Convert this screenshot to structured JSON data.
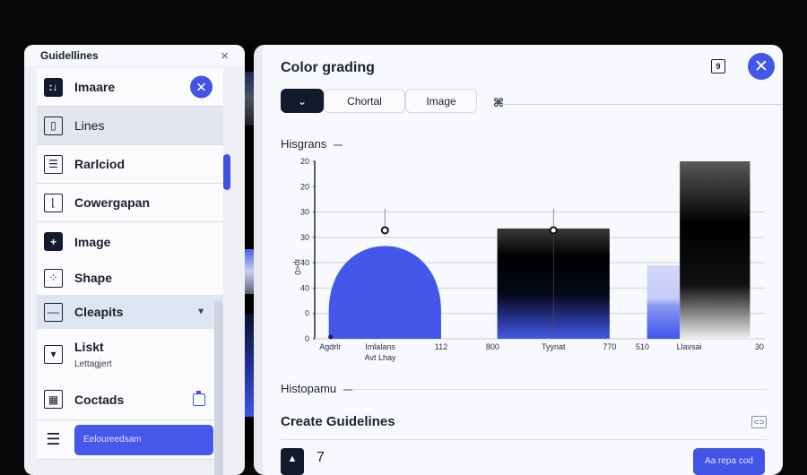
{
  "left_panel": {
    "title": "Guidellines",
    "close_icon": "×",
    "items": [
      {
        "label": "Imaare",
        "icon": "adjust-icon",
        "glyph": ":↓",
        "style": "solid",
        "trailing": "close-circle"
      },
      {
        "label": "Lines",
        "icon": "layers-icon",
        "glyph": "▯",
        "style": "plain"
      },
      {
        "label": "Rarlciod",
        "icon": "list-form-icon",
        "glyph": "☰",
        "style": "outline"
      },
      {
        "label": "Cowergapan",
        "icon": "chart-frame-icon",
        "glyph": "⌊",
        "style": "outline"
      },
      {
        "label": "Image",
        "icon": "plus-icon",
        "glyph": "+",
        "style": "solid"
      },
      {
        "label": "Shape",
        "icon": "shape-icon",
        "glyph": "⁘",
        "style": "outline"
      },
      {
        "label": "Cleapits",
        "icon": "window-icon",
        "glyph": "‒‒",
        "style": "outline",
        "trailing": "caret"
      },
      {
        "label": "Liskt",
        "sublabel": "Lettagjert",
        "icon": "dropdown-box-icon",
        "glyph": "▾",
        "style": "outline"
      },
      {
        "label": "Coctads",
        "icon": "map-icon",
        "glyph": "▦",
        "style": "outline",
        "trailing": "bag"
      },
      {
        "label": "Eeloureedsam",
        "icon": "folder-icon",
        "glyph": "☰",
        "style": "plain",
        "button": true
      }
    ],
    "close_circle_glyph": "✕",
    "caret_glyph": "▼"
  },
  "main_panel": {
    "title": "Color grading",
    "header_icon_glyph": "9",
    "close_glyph": "✕",
    "segments": {
      "dropdown_glyph": "⌄",
      "tab1": "Chortal",
      "tab2": "Image"
    },
    "grid_glyph": "⌘",
    "section1": "Hisgrans",
    "section2": "Histopamu",
    "create_title": "Create Guidelines",
    "link_glyph": "⊂⊃",
    "bottom_dark_glyph": "▲",
    "bottom_value": "7",
    "bottom_button": "Aa repa cod"
  },
  "colors": {
    "accent": "#4154e6",
    "dark": "#131a2e",
    "panel": "#f8f9fc"
  },
  "chart_data": {
    "type": "bar",
    "title": "Hisgrans",
    "ylabel": "Ip<0",
    "xlabel": "Avt Lhay",
    "y_tick_labels": [
      "20",
      "20",
      "30",
      "30",
      "40",
      "40",
      "0",
      "0"
    ],
    "x_tick_labels": [
      "Agdrlr",
      "Imlalans",
      "112",
      "800",
      "Tyynat",
      "770",
      "510",
      "Llavsai",
      "30"
    ],
    "ylim": [
      0,
      7
    ],
    "grid": true,
    "series": [
      {
        "name": "Blue dome",
        "kind": "dome",
        "color": "#4358ea",
        "x": [
          0.03,
          0.27
        ],
        "peak": 4.35,
        "marker_x": 0.13
      },
      {
        "name": "Dark gradient block",
        "kind": "bar",
        "color": "#000000",
        "base_color": "#4358ea",
        "x": [
          0.39,
          0.63
        ],
        "value": 4.35,
        "marker_x": 0.51
      },
      {
        "name": "Light blue bar",
        "kind": "bar",
        "color": "#c9d0f8",
        "base_color": "#4358ea",
        "x": [
          0.71,
          0.78
        ],
        "value": 2.9
      },
      {
        "name": "Tall grey gradient",
        "kind": "bar",
        "color": "#000000",
        "x": [
          0.78,
          0.93
        ],
        "value": 7.0
      }
    ]
  }
}
